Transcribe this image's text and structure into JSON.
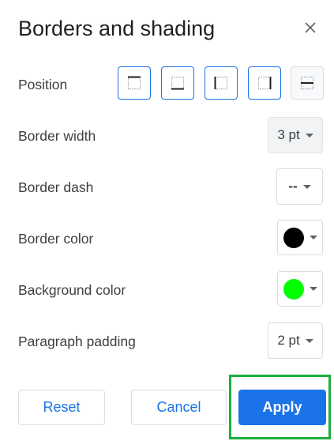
{
  "dialog": {
    "title": "Borders and shading",
    "rows": {
      "position": "Position",
      "border_width": "Border width",
      "border_dash": "Border dash",
      "border_color": "Border color",
      "background_color": "Background color",
      "paragraph_padding": "Paragraph padding"
    },
    "values": {
      "border_width": "3 pt",
      "border_dash": "--",
      "paragraph_padding": "2 pt"
    },
    "colors": {
      "border_color": "#000000",
      "background_color": "#00ff00",
      "accent": "#1a73e8",
      "highlight": "#1fae3e"
    },
    "position_buttons": [
      {
        "name": "top-border",
        "selected": true
      },
      {
        "name": "bottom-border",
        "selected": true
      },
      {
        "name": "left-border",
        "selected": true
      },
      {
        "name": "right-border",
        "selected": true
      },
      {
        "name": "between-border",
        "selected": false
      }
    ],
    "buttons": {
      "reset": "Reset",
      "cancel": "Cancel",
      "apply": "Apply"
    }
  }
}
